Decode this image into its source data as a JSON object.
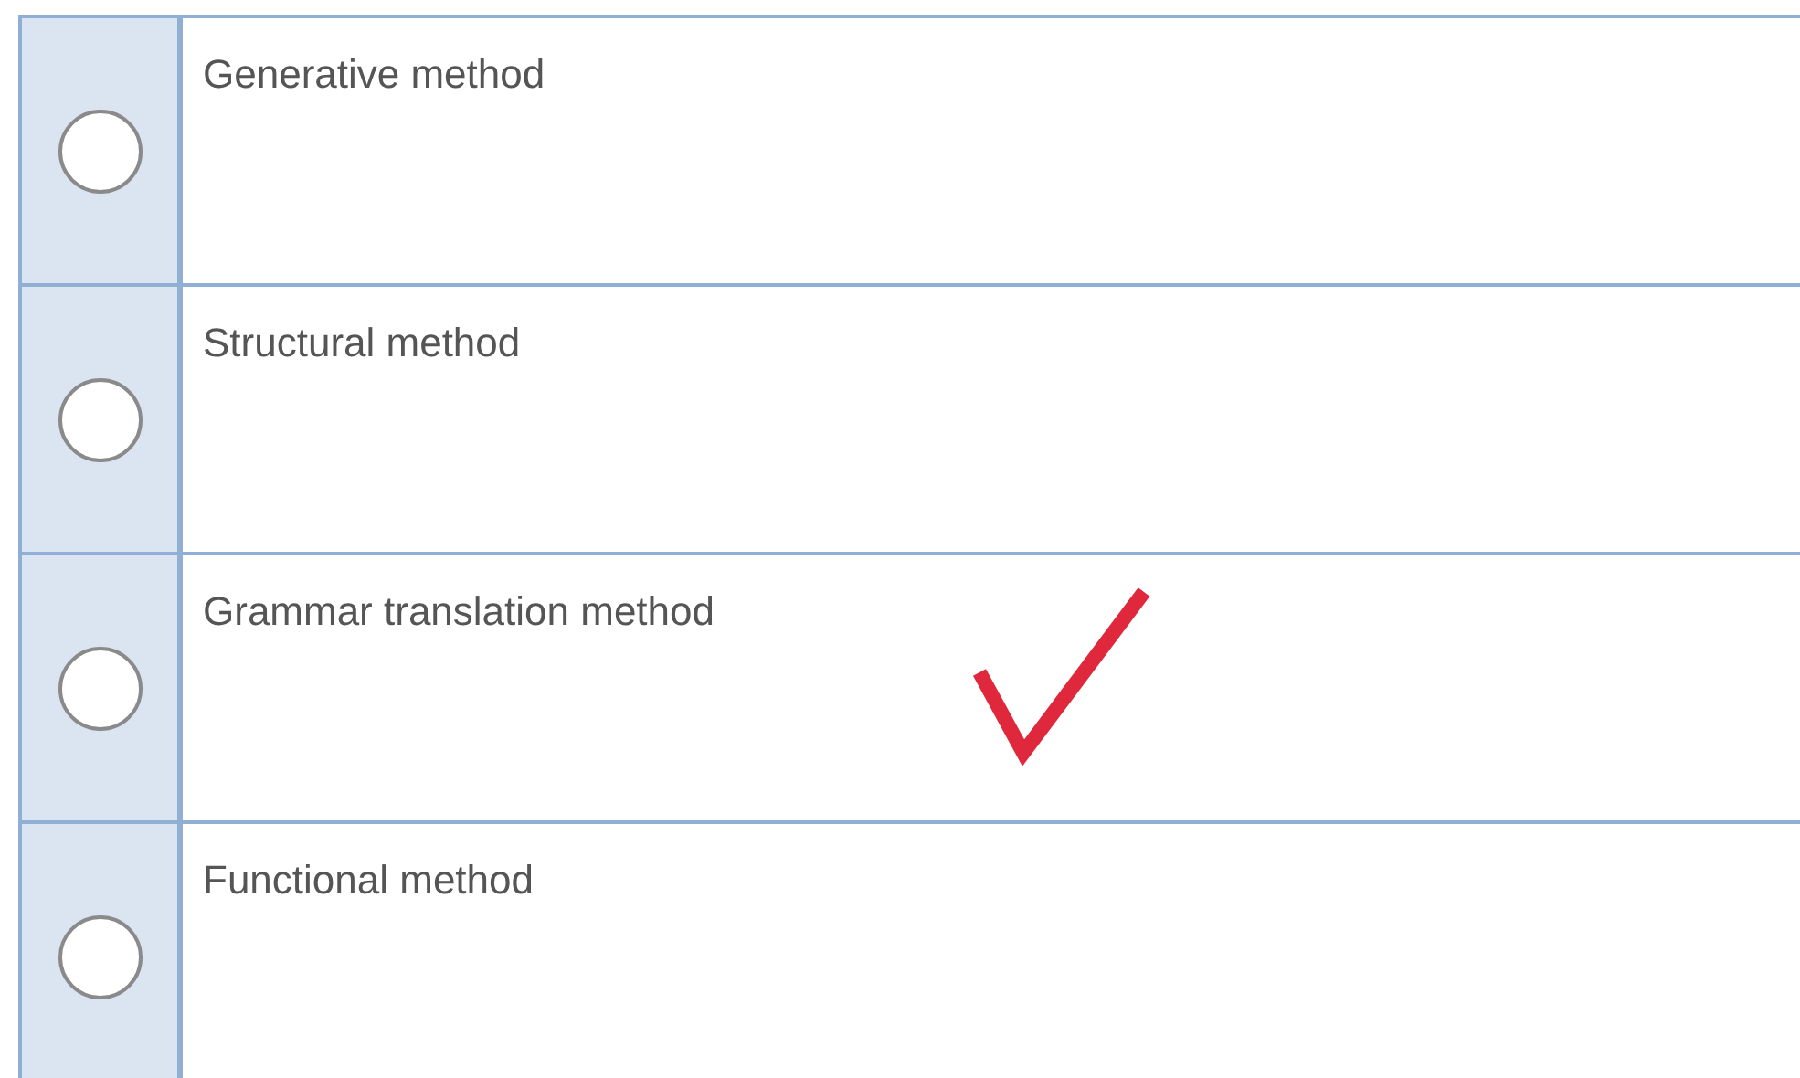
{
  "options": [
    {
      "label": "Generative method",
      "selected": false,
      "correct": false
    },
    {
      "label": "Structural method",
      "selected": false,
      "correct": false
    },
    {
      "label": "Grammar translation method",
      "selected": false,
      "correct": true
    },
    {
      "label": "Functional method",
      "selected": false,
      "correct": false
    }
  ]
}
